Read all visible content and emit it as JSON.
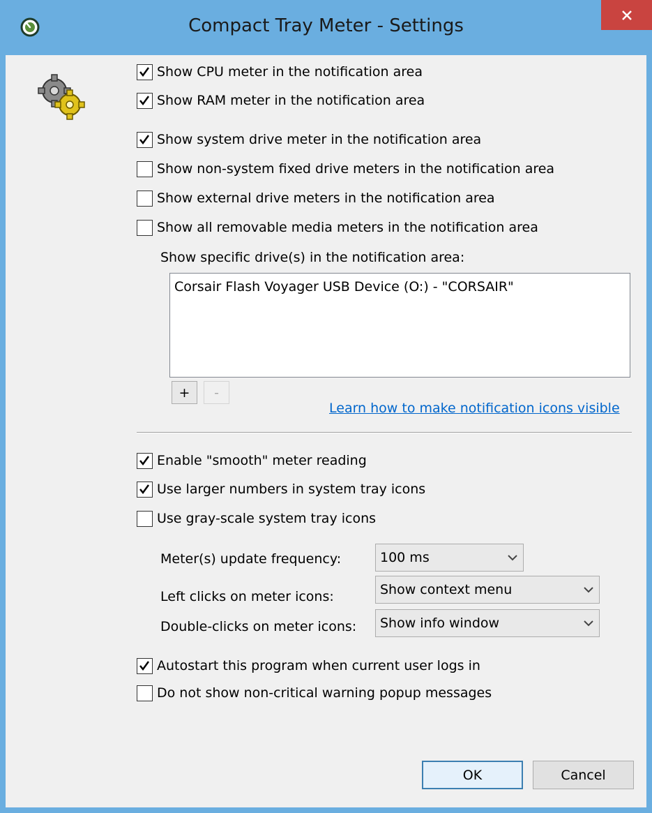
{
  "window": {
    "title": "Compact Tray Meter - Settings",
    "close_icon": "close-icon",
    "accent_color": "#6aaee0",
    "close_color": "#c94440"
  },
  "checkboxes": [
    {
      "label": "Show CPU meter in the notification area",
      "checked": true
    },
    {
      "label": "Show RAM meter in the notification area",
      "checked": true
    },
    {
      "label": "Show system drive meter in the notification area",
      "checked": true
    },
    {
      "label": "Show non-system fixed drive meters in the notification area",
      "checked": false
    },
    {
      "label": "Show external drive meters in the notification area",
      "checked": false
    },
    {
      "label": "Show all removable media meters in the notification area",
      "checked": false
    }
  ],
  "specific_drives": {
    "label": "Show specific drive(s) in the notification area:",
    "items": [
      "Corsair Flash Voyager USB Device (O:) - \"CORSAIR\""
    ],
    "add_label": "+",
    "remove_label": "-"
  },
  "link": "Learn how to make notification icons visible",
  "options": [
    {
      "label": "Enable \"smooth\" meter reading",
      "checked": true
    },
    {
      "label": "Use larger numbers in system tray icons",
      "checked": true
    },
    {
      "label": "Use gray-scale system tray icons",
      "checked": false
    }
  ],
  "dropdowns": [
    {
      "label": "Meter(s) update frequency:",
      "value": "100 ms"
    },
    {
      "label": "Left clicks on meter icons:",
      "value": "Show context menu"
    },
    {
      "label": "Double-clicks on meter icons:",
      "value": "Show info window"
    }
  ],
  "startup": [
    {
      "label": "Autostart this program when current user logs in",
      "checked": true
    },
    {
      "label": "Do not show non-critical warning popup messages",
      "checked": false
    }
  ],
  "buttons": {
    "ok": "OK",
    "cancel": "Cancel"
  }
}
